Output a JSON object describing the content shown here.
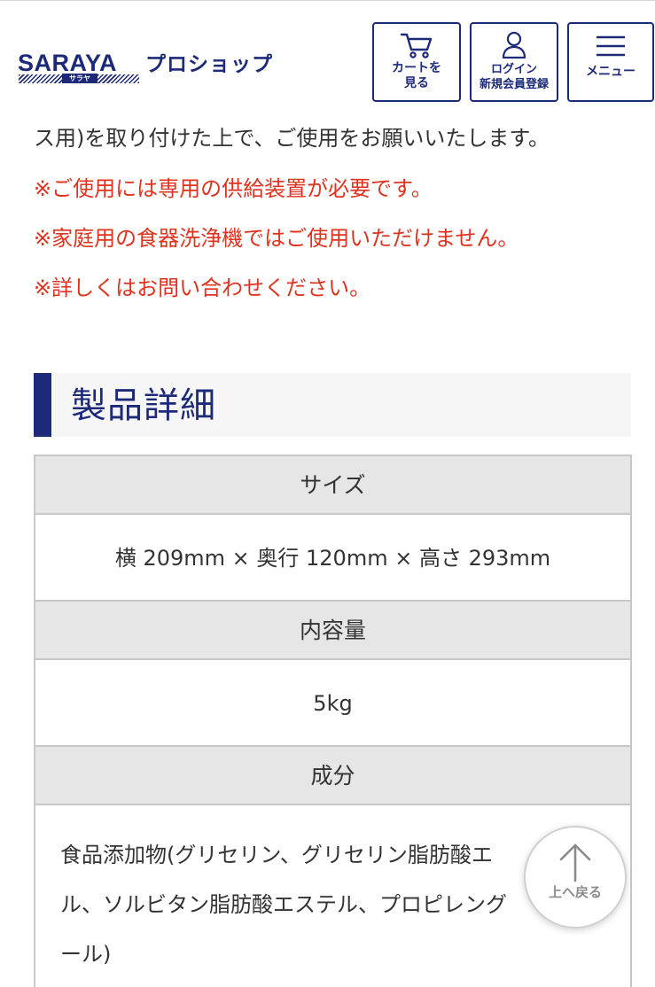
{
  "header": {
    "logo_main": "SARAYA",
    "logo_kana": "サラヤ",
    "logo_sub": "プロショップ",
    "cart_label": "カートを\n見る",
    "login_label": "ログイン\n新規会員登録",
    "menu_label": "メニュー",
    "brand_color": "#1d2a7a"
  },
  "intro": {
    "line1": "ス用)を取り付けた上で、ご使用をお願いいたします。",
    "note1": "※ご使用には専用の供給装置が必要です。",
    "note2": "※家庭用の食器洗浄機ではご使用いただけません。",
    "note3": "※詳しくはお問い合わせください。",
    "note_color": "#e0331f"
  },
  "details": {
    "title": "製品詳細",
    "rows": [
      {
        "label": "サイズ",
        "value": "横 209mm × 奥行 120mm × 高さ 293mm"
      },
      {
        "label": "内容量",
        "value": "5kg"
      },
      {
        "label": "成分",
        "value_lines": [
          "食品添加物(グリセリン、グリセリン脂肪酸エ",
          "ル、ソルビタン脂肪酸エステル、プロピレング",
          "ール)"
        ]
      }
    ]
  },
  "back_to_top": {
    "label": "上へ戻る",
    "icon": "arrow-up-icon"
  }
}
